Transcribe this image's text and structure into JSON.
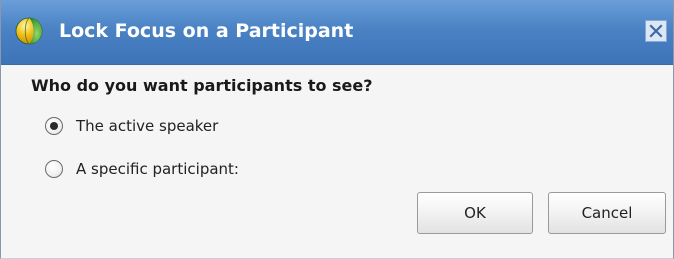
{
  "dialog": {
    "title": "Lock Focus on a Participant",
    "question": "Who do you want participants to see?",
    "options": [
      {
        "label": "The active speaker",
        "selected": true
      },
      {
        "label": "A specific participant:",
        "selected": false
      }
    ],
    "buttons": {
      "ok_label": "OK",
      "cancel_label": "Cancel"
    }
  },
  "icons": {
    "title_icon": "globe-icon",
    "close_icon": "close-icon"
  },
  "colors": {
    "titlebar": "#4a82c4",
    "title_text": "#ffffff",
    "body_background": "#f5f5f5"
  }
}
